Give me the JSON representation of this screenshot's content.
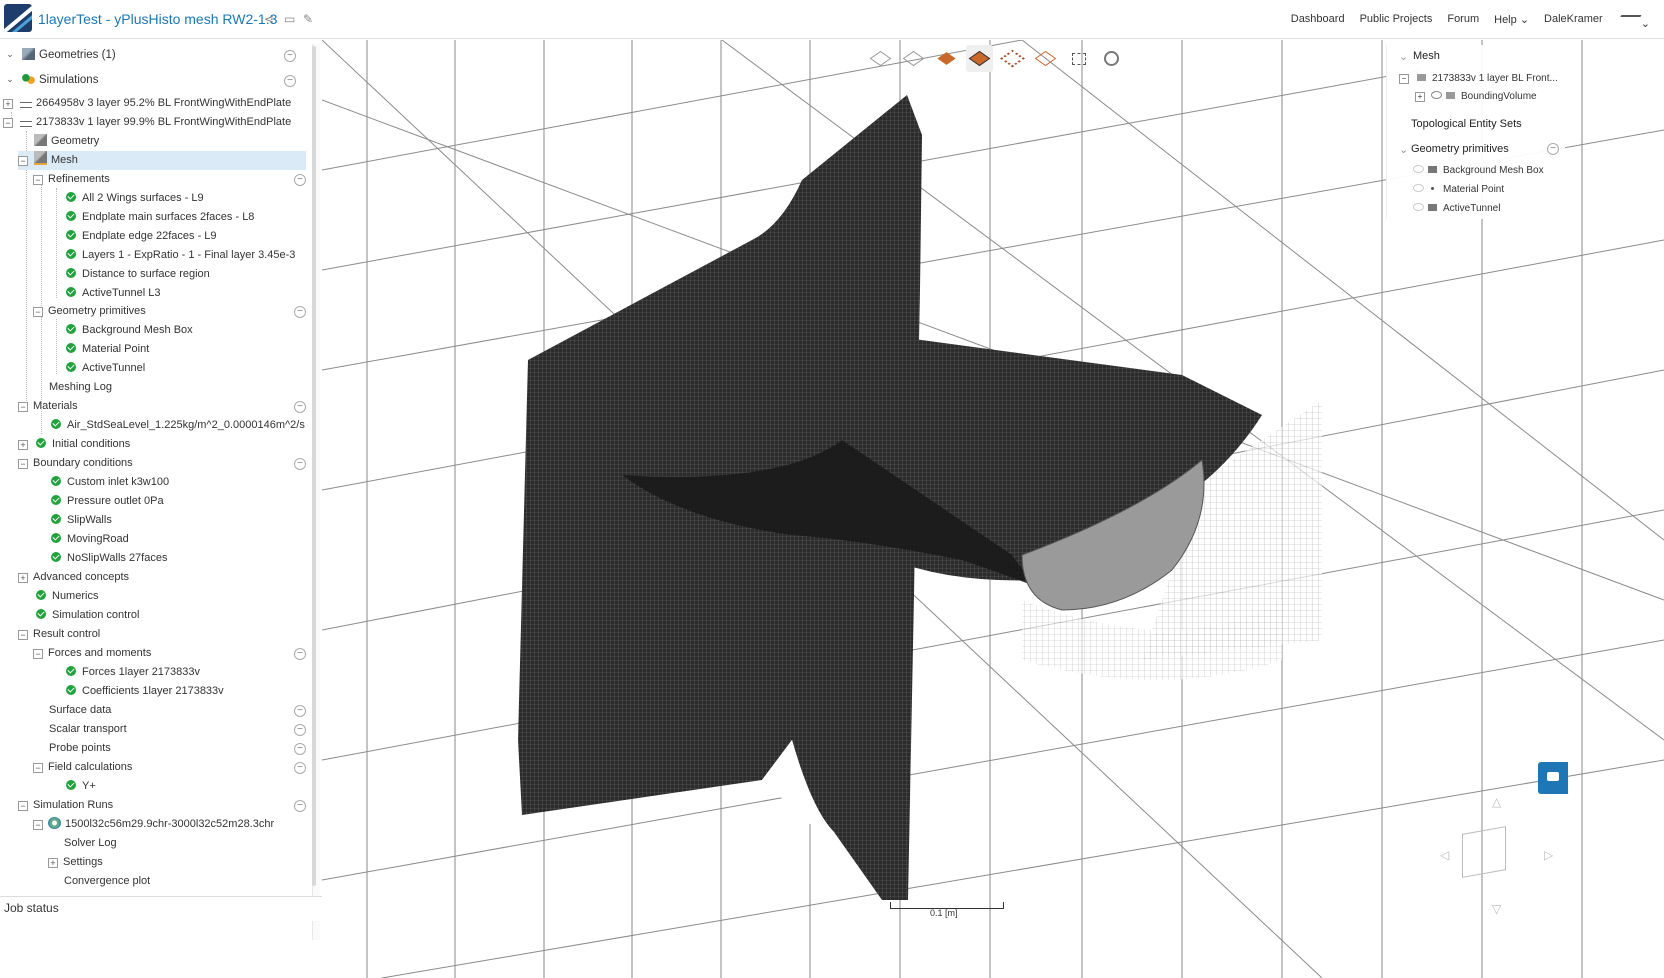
{
  "header": {
    "project_title": "1layerTest - yPlusHisto mesh RW2-1.3",
    "nav": [
      "Dashboard",
      "Public Projects",
      "Forum",
      "Help",
      "DaleKramer"
    ]
  },
  "tree": {
    "geometries": "Geometries (1)",
    "simulations": "Simulations",
    "sim1": "2664958v 3 layer 95.2% BL FrontWingWithEndPlate",
    "sim2": "2173833v 1 layer 99.9% BL FrontWingWithEndPlate",
    "geometry": "Geometry",
    "mesh": "Mesh",
    "refinements": "Refinements",
    "refinement_items": [
      "All 2 Wings surfaces - L9",
      "Endplate main surfaces 2faces - L8",
      "Endplate edge 22faces - L9",
      "Layers 1 - ExpRatio - 1 - Final layer 3.45e-3",
      "Distance to surface region",
      "ActiveTunnel L3"
    ],
    "geometry_primitives": "Geometry primitives",
    "primitive_items": [
      "Background Mesh Box",
      "Material Point",
      "ActiveTunnel"
    ],
    "meshing_log": "Meshing Log",
    "materials": "Materials",
    "material_item": "Air_StdSeaLevel_1.225kg/m^2_0.0000146m^2/s",
    "initial_conditions": "Initial conditions",
    "boundary_conditions": "Boundary conditions",
    "bc_items": [
      "Custom inlet k3w100",
      "Pressure outlet 0Pa",
      "SlipWalls",
      "MovingRoad",
      "NoSlipWalls 27faces"
    ],
    "advanced_concepts": "Advanced concepts",
    "numerics": "Numerics",
    "simulation_control": "Simulation control",
    "result_control": "Result control",
    "forces_and_moments": "Forces and moments",
    "forces_items": [
      "Forces 1layer 2173833v",
      "Coefficients 1layer 2173833v"
    ],
    "surface_data": "Surface data",
    "scalar_transport": "Scalar transport",
    "probe_points": "Probe points",
    "field_calculations": "Field calculations",
    "yplus": "Y+",
    "simulation_runs": "Simulation Runs",
    "run_name": "1500l32c56m29.9chr-3000l32c52m28.3chr",
    "solver_log": "Solver Log",
    "settings": "Settings",
    "convergence_plot": "Convergence plot"
  },
  "job_status": "Job status",
  "scene_panel": {
    "mesh": "Mesh",
    "mesh_item": "2173833v 1 layer BL Front...",
    "bounding_volume": "BoundingVolume",
    "topological_entity_sets": "Topological Entity Sets",
    "geometry_primitives": "Geometry primitives",
    "primitives": [
      "Background Mesh Box",
      "Material Point",
      "ActiveTunnel"
    ]
  },
  "scale_label": "0.1 [m]",
  "colors": {
    "accent": "#1e77b4",
    "ok_green": "#20a23c",
    "mesh": "#1a1a1a"
  }
}
